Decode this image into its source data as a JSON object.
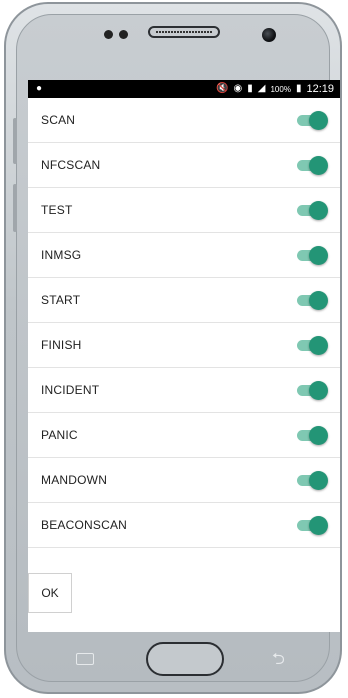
{
  "status_bar": {
    "notification_icon": "app-notification-icon",
    "icons": [
      "mute-icon",
      "wifi-icon",
      "sim-icon",
      "signal-icon"
    ],
    "battery_percent": "100%",
    "battery_icon": "battery-icon",
    "time": "12:19"
  },
  "toggles": [
    {
      "label": "SCAN",
      "on": true
    },
    {
      "label": "NFCSCAN",
      "on": true
    },
    {
      "label": "TEST",
      "on": true
    },
    {
      "label": "INMSG",
      "on": true
    },
    {
      "label": "START",
      "on": true
    },
    {
      "label": "FINISH",
      "on": true
    },
    {
      "label": "INCIDENT",
      "on": true
    },
    {
      "label": "PANIC",
      "on": true
    },
    {
      "label": "MANDOWN",
      "on": true
    },
    {
      "label": "BEACONSCAN",
      "on": true
    }
  ],
  "ok_label": "OK",
  "colors": {
    "switch_thumb": "#239576",
    "switch_track": "#7fc8b2",
    "status_bar": "#000000"
  }
}
